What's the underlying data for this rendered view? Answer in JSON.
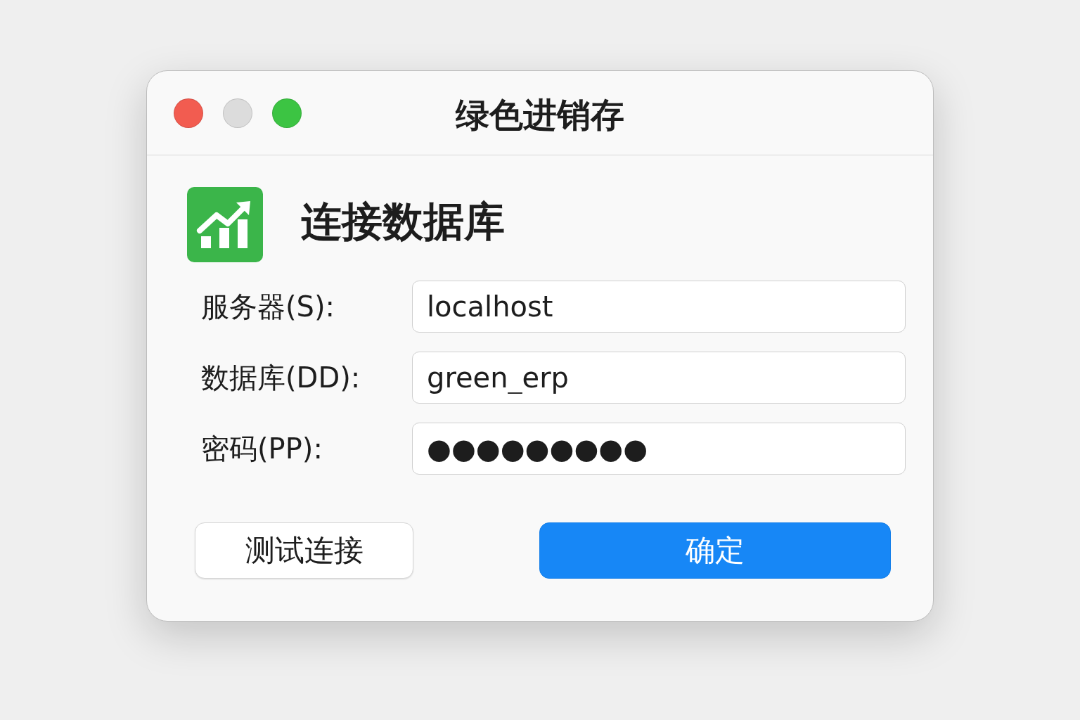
{
  "window": {
    "title": "绿色进销存",
    "controls": [
      {
        "kind": "close",
        "disabled": false
      },
      {
        "kind": "minimize",
        "disabled": true
      },
      {
        "kind": "zoom",
        "disabled": false
      }
    ]
  },
  "heading": "连接数据库",
  "fields": [
    {
      "label": "服务器(S):",
      "value": "localhost"
    },
    {
      "label": "数据库(DD):",
      "value": "green_erp"
    },
    {
      "label": "密码(PP):",
      "value": "●●●●●●●●●"
    }
  ],
  "buttons": [
    {
      "label": "测试连接",
      "kind": "secondary"
    },
    {
      "label": "确定",
      "kind": "primary"
    }
  ]
}
